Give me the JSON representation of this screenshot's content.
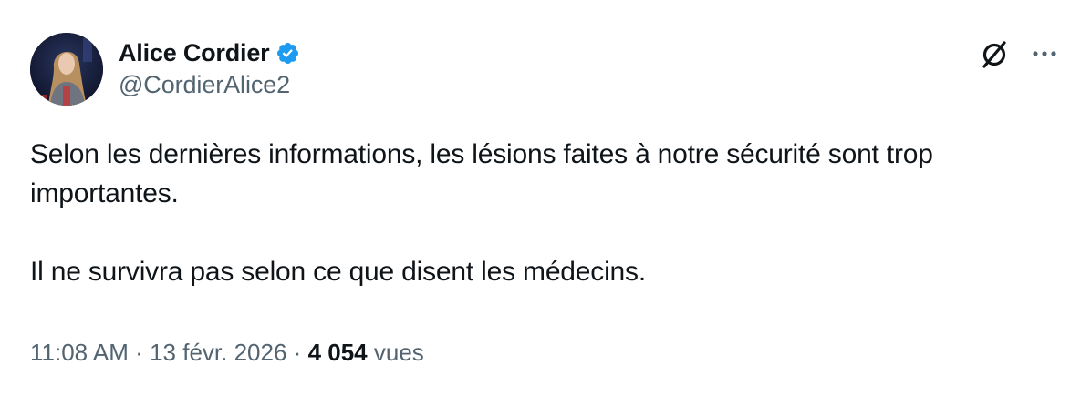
{
  "author": {
    "display_name": "Alice Cordier",
    "handle": "@CordierAlice2",
    "verified": true,
    "verified_color": "#1d9bf0"
  },
  "tweet": {
    "paragraphs": [
      "Selon les dernières informations, les lésions faites à notre sécurité sont trop importantes.",
      "Il ne survivra pas selon ce que disent les médecins."
    ],
    "time": "11:08 AM",
    "separator": "·",
    "date": "13 févr. 2026",
    "views_count": "4 054",
    "views_label": "vues"
  },
  "icons": {
    "grok": "grok-icon",
    "more": "more-options-icon",
    "verified": "verified-badge-icon"
  },
  "colors": {
    "text_primary": "#0f1419",
    "text_secondary": "#536471",
    "accent": "#1d9bf0"
  }
}
